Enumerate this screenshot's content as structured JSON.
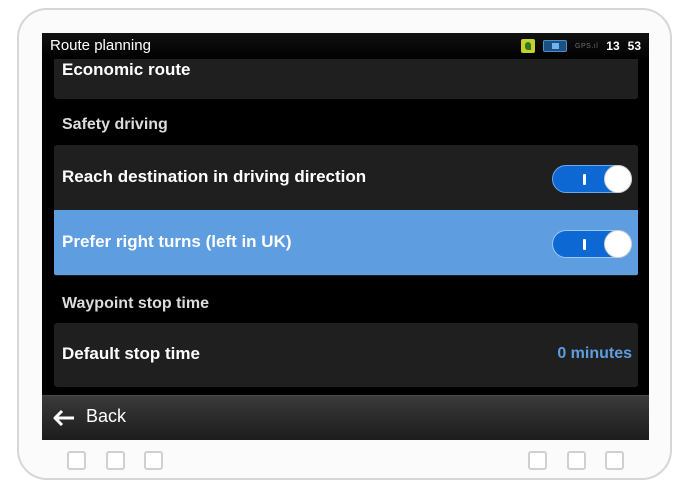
{
  "statusbar": {
    "title": "Route planning",
    "gps_label": "GPS.ıl",
    "time_hour": "13",
    "time_minute": "53",
    "icons": [
      "gps-status-icon",
      "battery-icon"
    ]
  },
  "list": {
    "partial_row_label": "Economic route",
    "sections": [
      {
        "header": "Safety driving",
        "rows": [
          {
            "label": "Reach destination in driving direction",
            "toggle_on": true,
            "highlighted": false
          },
          {
            "label": "Prefer right turns (left in UK)",
            "toggle_on": true,
            "highlighted": true
          }
        ]
      },
      {
        "header": "Waypoint stop time",
        "rows": [
          {
            "label": "Default stop time",
            "value": "0 minutes"
          }
        ]
      }
    ]
  },
  "backbar": {
    "label": "Back",
    "icon": "back-arrow-icon"
  },
  "colors": {
    "highlight": "#5e9de0",
    "toggle_on": "#0e68d4",
    "value_text": "#5e9de0",
    "card_bg": "#1f1f1f"
  }
}
